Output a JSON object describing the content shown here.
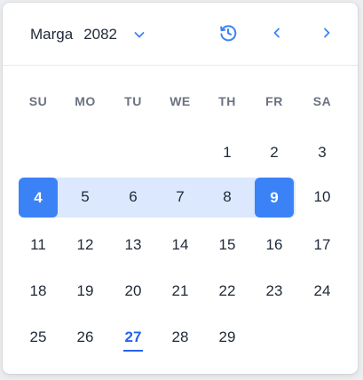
{
  "header": {
    "month": "Marga",
    "year": "2082",
    "icons": {
      "dropdown": "chevron-down-icon",
      "history": "history-clock-icon",
      "prev": "chevron-left-icon",
      "next": "chevron-right-icon"
    }
  },
  "colors": {
    "accent": "#3b82f6",
    "range": "#dbe8fd",
    "today": "#2563eb"
  },
  "weekdays": [
    "SU",
    "MO",
    "TU",
    "WE",
    "TH",
    "FR",
    "SA"
  ],
  "weeks": [
    [
      "",
      "",
      "",
      "",
      "1",
      "2",
      "3"
    ],
    [
      "4",
      "5",
      "6",
      "7",
      "8",
      "9",
      "10"
    ],
    [
      "11",
      "12",
      "13",
      "14",
      "15",
      "16",
      "17"
    ],
    [
      "18",
      "19",
      "20",
      "21",
      "22",
      "23",
      "24"
    ],
    [
      "25",
      "26",
      "27",
      "28",
      "29",
      "",
      ""
    ]
  ],
  "selection": {
    "start": "4",
    "end": "9"
  },
  "today": "27"
}
